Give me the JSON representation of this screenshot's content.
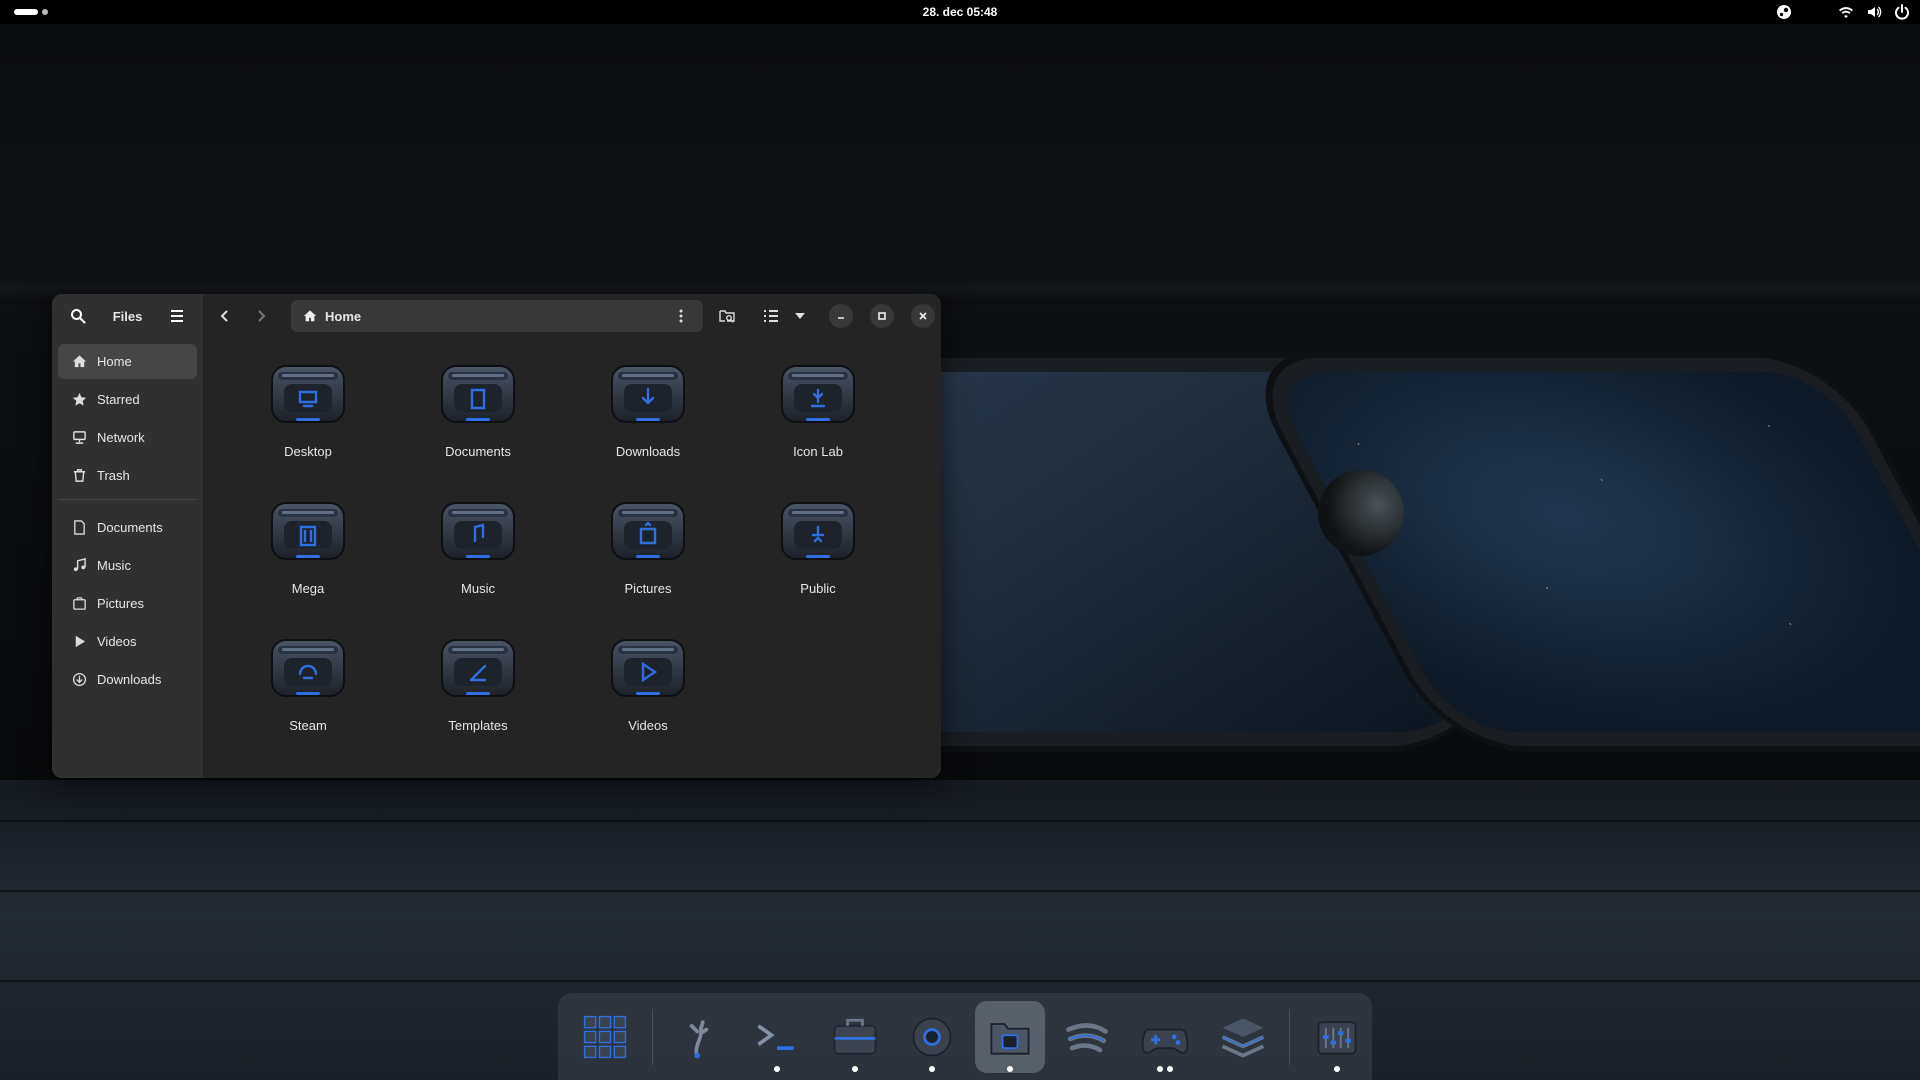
{
  "topbar": {
    "clock": "28. dec  05:48",
    "tray_icons": [
      "steam-icon",
      "wifi-icon",
      "volume-icon",
      "power-icon"
    ]
  },
  "files": {
    "sidebar": {
      "title": "Files",
      "places": [
        {
          "label": "Home",
          "icon": "home-icon",
          "active": true
        },
        {
          "label": "Starred",
          "icon": "star-icon"
        },
        {
          "label": "Network",
          "icon": "network-icon"
        },
        {
          "label": "Trash",
          "icon": "trash-icon"
        }
      ],
      "bookmarks": [
        {
          "label": "Documents",
          "icon": "document-icon"
        },
        {
          "label": "Music",
          "icon": "music-icon"
        },
        {
          "label": "Pictures",
          "icon": "pictures-icon"
        },
        {
          "label": "Videos",
          "icon": "videos-icon"
        },
        {
          "label": "Downloads",
          "icon": "download-icon"
        }
      ]
    },
    "path": "Home",
    "folders": [
      {
        "label": "Desktop",
        "icon": "desktop-folder-icon"
      },
      {
        "label": "Documents",
        "icon": "documents-folder-icon"
      },
      {
        "label": "Downloads",
        "icon": "downloads-folder-icon"
      },
      {
        "label": "Icon Lab",
        "icon": "iconlab-folder-icon"
      },
      {
        "label": "Mega",
        "icon": "mega-folder-icon"
      },
      {
        "label": "Music",
        "icon": "music-folder-icon"
      },
      {
        "label": "Pictures",
        "icon": "pictures-folder-icon"
      },
      {
        "label": "Public",
        "icon": "public-folder-icon"
      },
      {
        "label": "Steam",
        "icon": "steam-folder-icon"
      },
      {
        "label": "Templates",
        "icon": "templates-folder-icon"
      },
      {
        "label": "Videos",
        "icon": "videos-folder-icon"
      }
    ]
  },
  "dock": {
    "items": [
      {
        "name": "app-grid",
        "running": 0
      },
      {
        "name": "tweaks",
        "running": 0
      },
      {
        "name": "terminal",
        "running": 1
      },
      {
        "name": "toolbox",
        "running": 1
      },
      {
        "name": "browser",
        "running": 1
      },
      {
        "name": "files",
        "running": 1,
        "focused": true
      },
      {
        "name": "spotify",
        "running": 0
      },
      {
        "name": "gamepad",
        "running": 2
      },
      {
        "name": "stack",
        "running": 0
      },
      {
        "name": "mixer",
        "running": 1
      }
    ]
  },
  "colors": {
    "accent": "#2f6fe0",
    "window_bg": "#242424",
    "sidebar_bg": "#303030"
  }
}
